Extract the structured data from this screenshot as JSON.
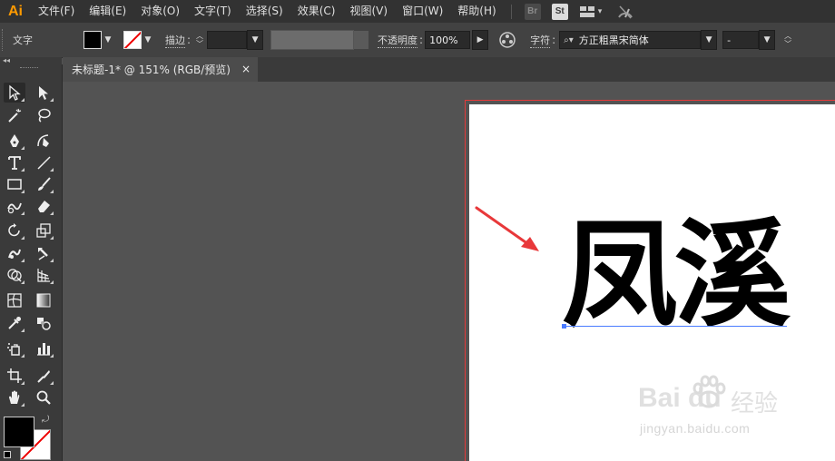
{
  "app": {
    "logo": "Ai"
  },
  "menu": {
    "items": [
      "文件(F)",
      "编辑(E)",
      "对象(O)",
      "文字(T)",
      "选择(S)",
      "效果(C)",
      "视图(V)",
      "窗口(W)",
      "帮助(H)"
    ],
    "badges": {
      "br": "Br",
      "st": "St"
    }
  },
  "control": {
    "tool_label": "文字",
    "stroke_label": "描边",
    "opacity_label": "不透明度",
    "opacity_value": "100%",
    "char_label": "字符",
    "font_name": "方正粗黑宋简体",
    "font_style": "-"
  },
  "document": {
    "tab_title": "未标题-1* @ 151% (RGB/预览)",
    "close": "×"
  },
  "artboard": {
    "text": "凤溪"
  },
  "watermark": {
    "brand": "Bai  du",
    "cn": "经验",
    "url": "jingyan.baidu.com"
  },
  "colors": {
    "accent": "#ff9a00",
    "arrow": "#e8383a",
    "artboard_border": "#e53a3a",
    "baseline": "#4a7bff"
  },
  "icons": [
    "selection-icon",
    "direct-selection-icon",
    "magic-wand-icon",
    "lasso-icon",
    "pen-icon",
    "curvature-icon",
    "type-icon",
    "line-icon",
    "rectangle-icon",
    "paintbrush-icon",
    "shaper-icon",
    "eraser-icon",
    "rotate-icon",
    "scale-icon",
    "warp-icon",
    "puppet-warp-icon",
    "shape-builder-icon",
    "perspective-grid-icon",
    "mesh-icon",
    "gradient-icon",
    "eyedropper-icon",
    "blend-icon",
    "symbol-sprayer-icon",
    "column-graph-icon",
    "artboard-icon",
    "slice-icon",
    "hand-icon",
    "zoom-icon"
  ]
}
